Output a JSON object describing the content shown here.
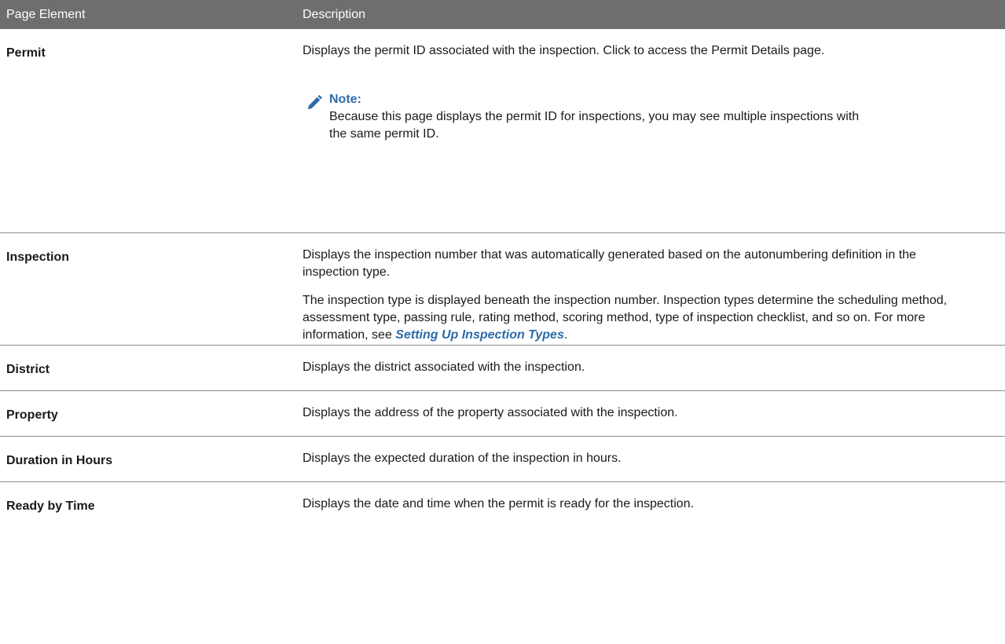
{
  "header": {
    "col1": "Page Element",
    "col2": "Description"
  },
  "rows": [
    {
      "element": "Permit",
      "description": [
        "Displays the permit ID associated with the inspection. Click to access the Permit Details page."
      ],
      "note": {
        "icon": "pencil-icon",
        "title": "Note:",
        "text": "Because this page displays the permit ID for inspections, you may see multiple inspections with the same permit ID."
      }
    },
    {
      "element": "Inspection",
      "description": [
        "Displays the inspection number that was automatically generated based on the autonumbering definition in the inspection type.",
        "The inspection type is displayed beneath the inspection number. Inspection types determine the scheduling method, assessment type, passing rule, rating method, scoring method, type of inspection checklist, and so on. For more information, see"
      ],
      "link_text": "Setting Up Inspection Types",
      "link_suffix": "."
    },
    {
      "element": "District",
      "description": [
        "Displays the district associated with the inspection."
      ]
    },
    {
      "element": "Property",
      "description": [
        "Displays the address of the property associated with the inspection."
      ]
    },
    {
      "element": "Duration in Hours",
      "description": [
        "Displays the expected duration of the inspection in hours."
      ]
    },
    {
      "element": "Ready by Time",
      "description": [
        "Displays the date and time when the permit is ready for the inspection."
      ]
    }
  ],
  "colors": {
    "header_bg": "#6e6e6e",
    "accent": "#2e6ba8",
    "divider": "#8a8a8a"
  }
}
